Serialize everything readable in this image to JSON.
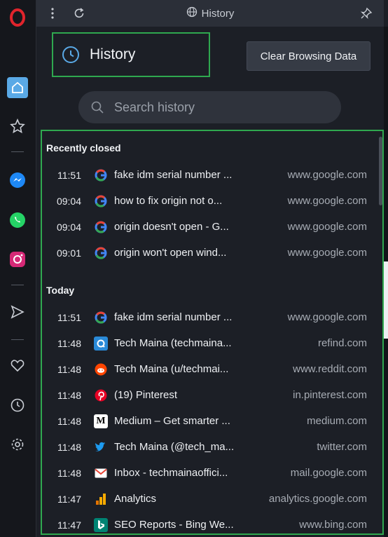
{
  "window": {
    "title": "History"
  },
  "header": {
    "title": "History",
    "clear_button": "Clear Browsing Data"
  },
  "search": {
    "placeholder": "Search history"
  },
  "sections": [
    {
      "label": "Recently closed",
      "items": [
        {
          "time": "11:51",
          "title": "fake idm serial number ...",
          "domain": "www.google.com",
          "icon": "google-icon"
        },
        {
          "time": "09:04",
          "title": "how to fix origin not o...",
          "domain": "www.google.com",
          "icon": "google-icon"
        },
        {
          "time": "09:04",
          "title": "origin doesn't open - G...",
          "domain": "www.google.com",
          "icon": "google-icon"
        },
        {
          "time": "09:01",
          "title": "origin won't open wind...",
          "domain": "www.google.com",
          "icon": "google-icon"
        }
      ]
    },
    {
      "label": "Today",
      "items": [
        {
          "time": "11:51",
          "title": "fake idm serial number ...",
          "domain": "www.google.com",
          "icon": "google-icon"
        },
        {
          "time": "11:48",
          "title": "Tech Maina (techmaina...",
          "domain": "refind.com",
          "icon": "refind-icon"
        },
        {
          "time": "11:48",
          "title": "Tech Maina (u/techmai...",
          "domain": "www.reddit.com",
          "icon": "reddit-icon"
        },
        {
          "time": "11:48",
          "title": "(19) Pinterest",
          "domain": "in.pinterest.com",
          "icon": "pinterest-icon"
        },
        {
          "time": "11:48",
          "title": "Medium – Get smarter ...",
          "domain": "medium.com",
          "icon": "medium-icon"
        },
        {
          "time": "11:48",
          "title": "Tech Maina (@tech_ma...",
          "domain": "twitter.com",
          "icon": "twitter-icon"
        },
        {
          "time": "11:48",
          "title": "Inbox - techmainaoffici...",
          "domain": "mail.google.com",
          "icon": "gmail-icon"
        },
        {
          "time": "11:47",
          "title": "Analytics",
          "domain": "analytics.google.com",
          "icon": "analytics-icon"
        },
        {
          "time": "11:47",
          "title": "SEO Reports - Bing We...",
          "domain": "www.bing.com",
          "icon": "bing-icon"
        }
      ]
    }
  ],
  "colors": {
    "highlight_border": "#2fa84f",
    "background": "#1c1f26",
    "sidebar": "#15171c",
    "accent_blue": "#5aa9e6"
  }
}
